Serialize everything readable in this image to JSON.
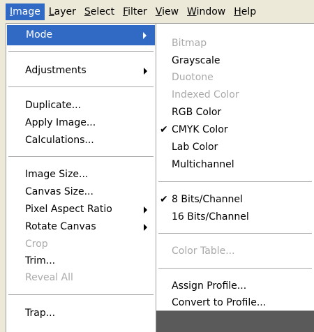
{
  "menubar": {
    "items": [
      "Image",
      "Layer",
      "Select",
      "Filter",
      "View",
      "Window",
      "Help"
    ]
  },
  "image_menu": {
    "items": [
      {
        "label": "Mode",
        "highlighted": true,
        "submenu": true
      },
      {
        "label": "Adjustments",
        "submenu": true
      },
      {
        "label": "Duplicate..."
      },
      {
        "label": "Apply Image..."
      },
      {
        "label": "Calculations..."
      },
      {
        "label": "Image Size..."
      },
      {
        "label": "Canvas Size..."
      },
      {
        "label": "Pixel Aspect Ratio",
        "submenu": true
      },
      {
        "label": "Rotate Canvas",
        "submenu": true
      },
      {
        "label": "Crop",
        "disabled": true
      },
      {
        "label": "Trim..."
      },
      {
        "label": "Reveal All",
        "disabled": true
      },
      {
        "label": "Trap..."
      }
    ]
  },
  "mode_menu": {
    "items": [
      {
        "label": "Bitmap",
        "disabled": true
      },
      {
        "label": "Grayscale"
      },
      {
        "label": "Duotone",
        "disabled": true
      },
      {
        "label": "Indexed Color",
        "disabled": true
      },
      {
        "label": "RGB Color"
      },
      {
        "label": "CMYK Color",
        "checked": true
      },
      {
        "label": "Lab Color"
      },
      {
        "label": "Multichannel"
      },
      {
        "label": "8 Bits/Channel",
        "checked": true
      },
      {
        "label": "16 Bits/Channel"
      },
      {
        "label": "Color Table...",
        "disabled": true
      },
      {
        "label": "Assign Profile..."
      },
      {
        "label": "Convert to Profile..."
      }
    ]
  },
  "icons": {
    "check": "✔"
  },
  "colors": {
    "highlight": "#316ac5",
    "disabled_text": "#a9a9a9",
    "menu_bg": "#ffffff",
    "chrome": "#ece9d8"
  }
}
